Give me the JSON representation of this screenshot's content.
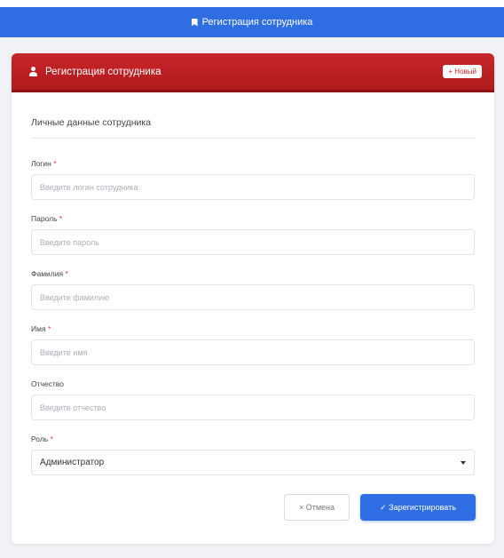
{
  "topbar": {
    "title": "Регистрация сотрудника",
    "icon": "bookmark-icon"
  },
  "card": {
    "title": "Регистрация сотрудника",
    "icon": "user-icon",
    "badge": "+ Новый",
    "header_color": "#c8262a"
  },
  "section_title": "Личные данные сотрудника",
  "fields": {
    "login": {
      "label": "Логин",
      "required": "*",
      "placeholder": "Введите логин сотрудника"
    },
    "password": {
      "label": "Пароль",
      "required": "*",
      "placeholder": "Введите пароль"
    },
    "lastname": {
      "label": "Фамилия",
      "required": "*",
      "placeholder": "Введите фамилию"
    },
    "firstname": {
      "label": "Имя",
      "required": "*",
      "placeholder": "Введите имя"
    },
    "patronymic": {
      "label": "Отчество",
      "placeholder": "Введите отчество"
    },
    "role": {
      "label": "Роль",
      "required": "*",
      "value": "Администратор"
    }
  },
  "buttons": {
    "cancel": "× Отмена",
    "submit": "✓ Зарегистрировать"
  },
  "colors": {
    "accent": "#2f6de3",
    "danger": "#c8262a"
  }
}
